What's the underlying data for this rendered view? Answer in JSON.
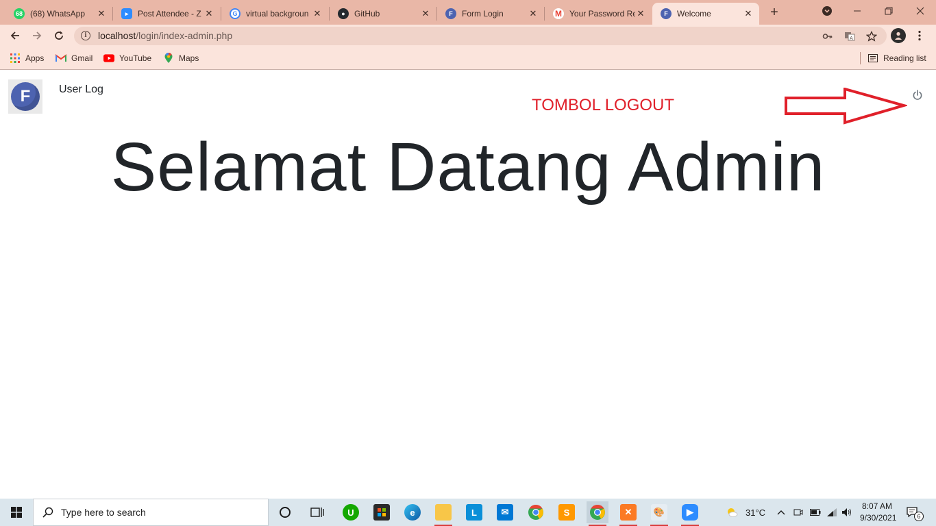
{
  "browser": {
    "tabs": [
      {
        "title": "(68) WhatsApp",
        "icon": "whatsapp-icon",
        "badge": "68",
        "color": "#25d366",
        "active": false
      },
      {
        "title": "Post Attendee - Z",
        "icon": "zoom-icon",
        "color": "#2d8cff",
        "active": false
      },
      {
        "title": "virtual backgroun",
        "icon": "google-icon",
        "color": "#4285f4",
        "active": false
      },
      {
        "title": "GitHub",
        "icon": "github-icon",
        "color": "#24292e",
        "active": false
      },
      {
        "title": "Form Login",
        "icon": "form-icon",
        "color": "#4d63b0",
        "active": false
      },
      {
        "title": "Your Password Re",
        "icon": "gmail-icon",
        "color": "#ea4335",
        "active": false
      },
      {
        "title": "Welcome",
        "icon": "form-icon",
        "color": "#4d63b0",
        "active": true
      }
    ],
    "address": {
      "host": "localhost",
      "path": "/login/index-admin.php"
    },
    "bookmarks": [
      {
        "label": "Apps",
        "icon": "apps-grid-icon"
      },
      {
        "label": "Gmail",
        "icon": "gmail-icon"
      },
      {
        "label": "YouTube",
        "icon": "youtube-icon"
      },
      {
        "label": "Maps",
        "icon": "maps-pin-icon"
      }
    ],
    "reading_list": "Reading list"
  },
  "page": {
    "logo_letter": "F",
    "user_log": "User Log",
    "annotation": "TOMBOL LOGOUT",
    "welcome_heading": "Selamat Datang Admin",
    "annotation_color": "#e0202a"
  },
  "taskbar": {
    "search_placeholder": "Type here to search",
    "weather": "31°C",
    "time": "8:07 AM",
    "date": "9/30/2021",
    "notification_count": "6"
  }
}
